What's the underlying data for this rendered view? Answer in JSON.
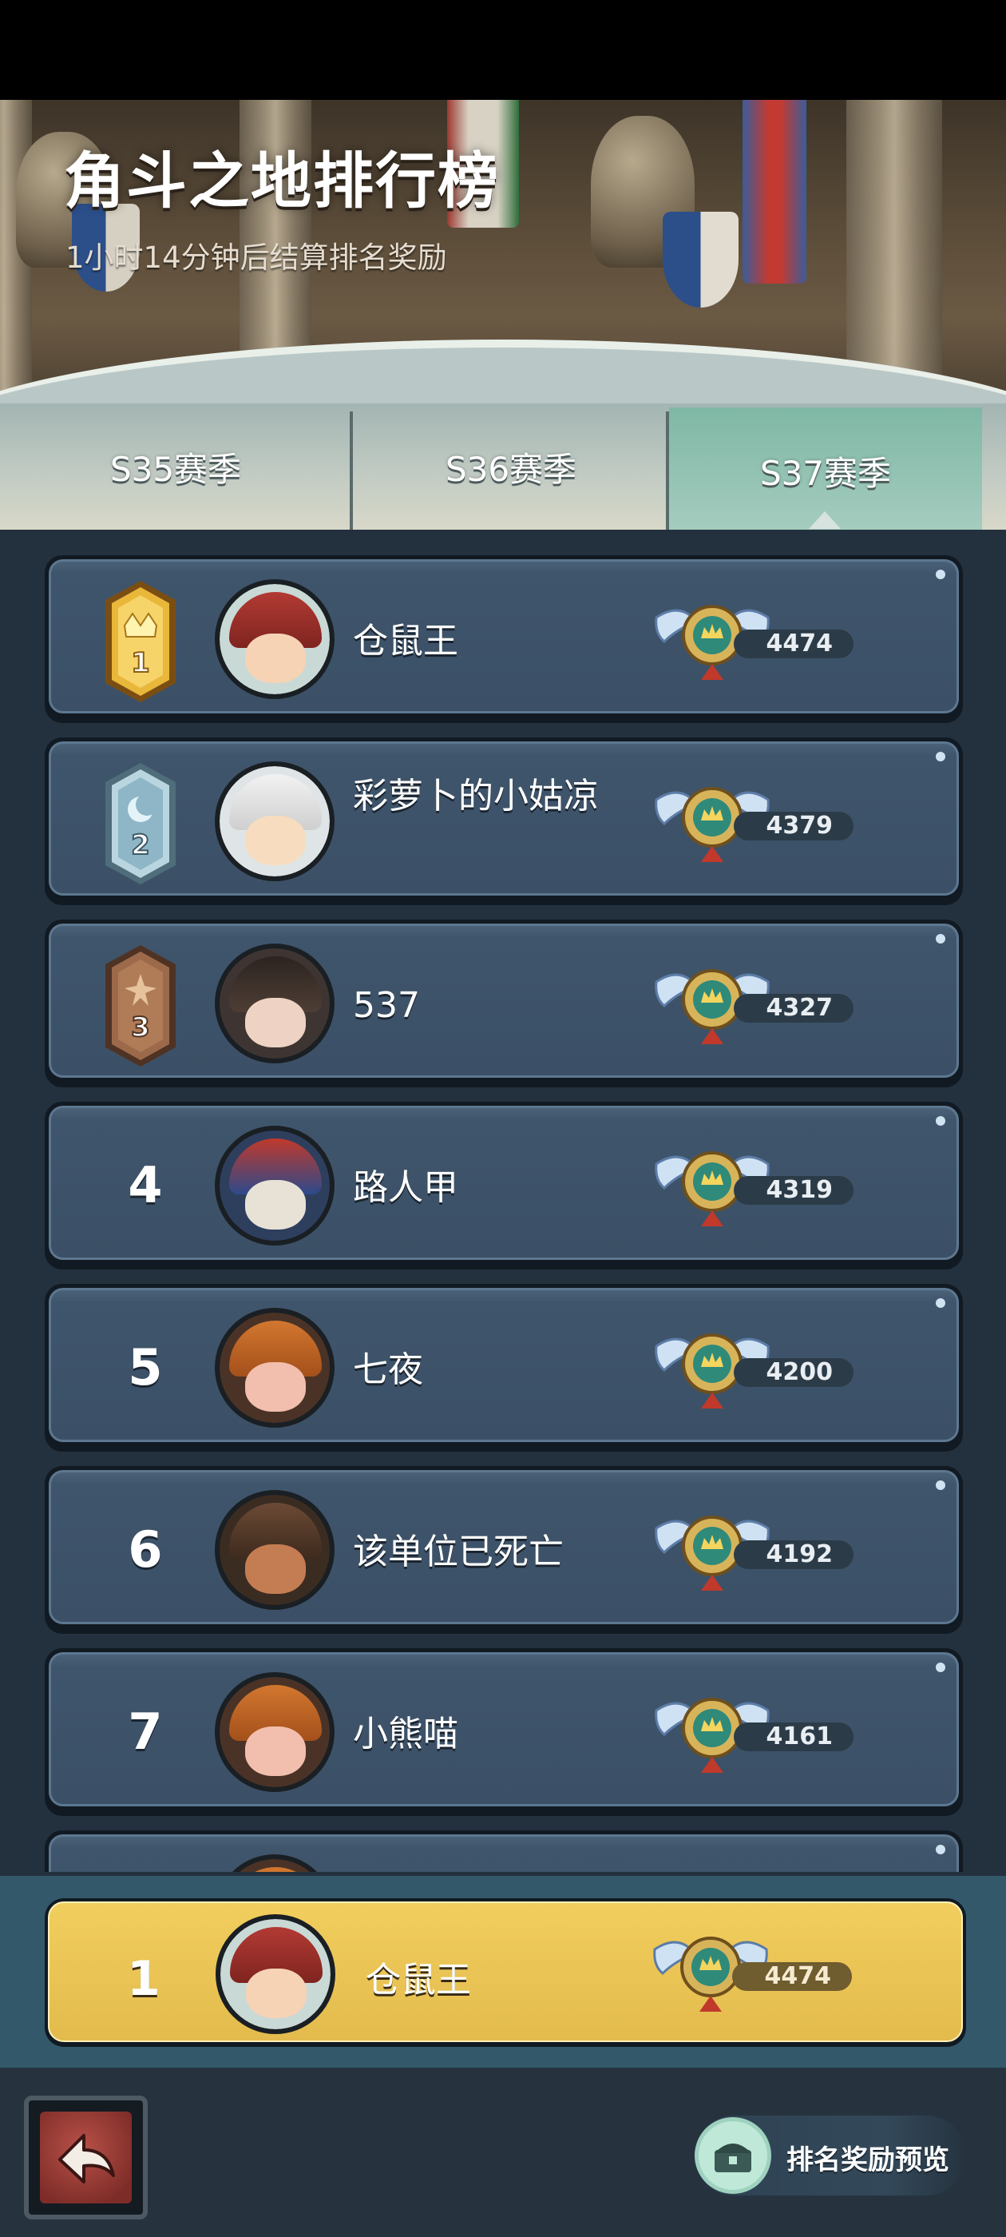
{
  "header": {
    "title": "角斗之地排行榜",
    "subtitle": "1小时14分钟后结算排名奖励"
  },
  "tabs": [
    {
      "label": "S35赛季",
      "active": false
    },
    {
      "label": "S36赛季",
      "active": false
    },
    {
      "label": "S37赛季",
      "active": true
    }
  ],
  "leaderboard": {
    "rows": [
      {
        "rank": "1",
        "name": "仓鼠王",
        "score": "4474",
        "badge": "gold",
        "avatar": "red-beanie"
      },
      {
        "rank": "2",
        "name": "彩萝卜的小姑凉",
        "score": "4379",
        "badge": "silver",
        "avatar": "panda-hood"
      },
      {
        "rank": "3",
        "name": "537",
        "score": "4327",
        "badge": "bronze",
        "avatar": "curly-hair"
      },
      {
        "rank": "4",
        "name": "路人甲",
        "score": "4319",
        "badge": "none",
        "avatar": "skull-blue-hat"
      },
      {
        "rank": "5",
        "name": "七夜",
        "score": "4200",
        "badge": "none",
        "avatar": "pumpkin"
      },
      {
        "rank": "6",
        "name": "该单位已死亡",
        "score": "4192",
        "badge": "none",
        "avatar": "cowboy-hat"
      },
      {
        "rank": "7",
        "name": "小熊喵",
        "score": "4161",
        "badge": "none",
        "avatar": "pumpkin"
      }
    ]
  },
  "my_rank": {
    "rank": "1",
    "name": "仓鼠王",
    "score": "4474",
    "avatar": "red-beanie"
  },
  "footer": {
    "back_icon": "back-arrow-icon",
    "reward_preview_label": "排名奖励预览",
    "reward_icon": "treasure-chest-icon"
  },
  "colors": {
    "row_bg": "#3f556b",
    "my_row_bg": "#e8c252",
    "active_tab": "#8fc2b0",
    "gold": "#e3b232",
    "silver": "#b9d6e0",
    "bronze": "#9c6a4a"
  }
}
